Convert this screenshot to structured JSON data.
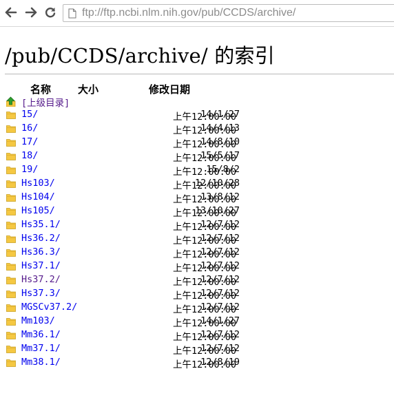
{
  "browser": {
    "url": "ftp://ftp.ncbi.nlm.nih.gov/pub/CCDS/archive/",
    "back_icon": "arrow-left-icon",
    "forward_icon": "arrow-right-icon",
    "reload_icon": "reload-icon",
    "page_icon": "page-icon"
  },
  "page": {
    "title": "/pub/CCDS/archive/ 的索引",
    "columns": {
      "name": "名称",
      "size": "大小",
      "date": "修改日期"
    },
    "parent_link": "[上级目录]",
    "entries": [
      {
        "name": "15/",
        "date": "14/1/27",
        "time": "上午12:00:00"
      },
      {
        "name": "16/",
        "date": "14/4/13",
        "time": "上午12:00:00"
      },
      {
        "name": "17/",
        "date": "14/8/10",
        "time": "上午12:00:00"
      },
      {
        "name": "18/",
        "date": "15/5/17",
        "time": "上午12:00:00"
      },
      {
        "name": "19/",
        "date": "15/8/2",
        "time": "上午12:00:00"
      },
      {
        "name": "Hs103/",
        "date": "12/10/28",
        "time": "上午12:00:00"
      },
      {
        "name": "Hs104/",
        "date": "13/8/12",
        "time": "上午12:00:00"
      },
      {
        "name": "Hs105/",
        "date": "13/10/27",
        "time": "上午12:00:00"
      },
      {
        "name": "Hs35.1/",
        "date": "12/7/12",
        "time": "上午12:00:00"
      },
      {
        "name": "Hs36.2/",
        "date": "12/7/12",
        "time": "上午12:00:00"
      },
      {
        "name": "Hs36.3/",
        "date": "12/7/12",
        "time": "上午12:00:00"
      },
      {
        "name": "Hs37.1/",
        "date": "12/7/12",
        "time": "上午12:00:00"
      },
      {
        "name": "Hs37.2/",
        "date": "12/7/12",
        "time": "上午12:00:00"
      },
      {
        "name": "Hs37.3/",
        "date": "12/7/12",
        "time": "上午12:00:00"
      },
      {
        "name": "MGSCv37.2/",
        "date": "12/7/12",
        "time": "上午12:00:00"
      },
      {
        "name": "Mm103/",
        "date": "14/1/27",
        "time": "上午12:00:00"
      },
      {
        "name": "Mm36.1/",
        "date": "12/7/12",
        "time": "上午12:00:00"
      },
      {
        "name": "Mm37.1/",
        "date": "12/7/12",
        "time": "上午12:00:00"
      },
      {
        "name": "Mm38.1/",
        "date": "12/8/19",
        "time": "上午12:00:00"
      }
    ]
  },
  "colors": {
    "link": "#0000ee",
    "visited_link": "#551a8b",
    "folder": "#f5c842"
  }
}
